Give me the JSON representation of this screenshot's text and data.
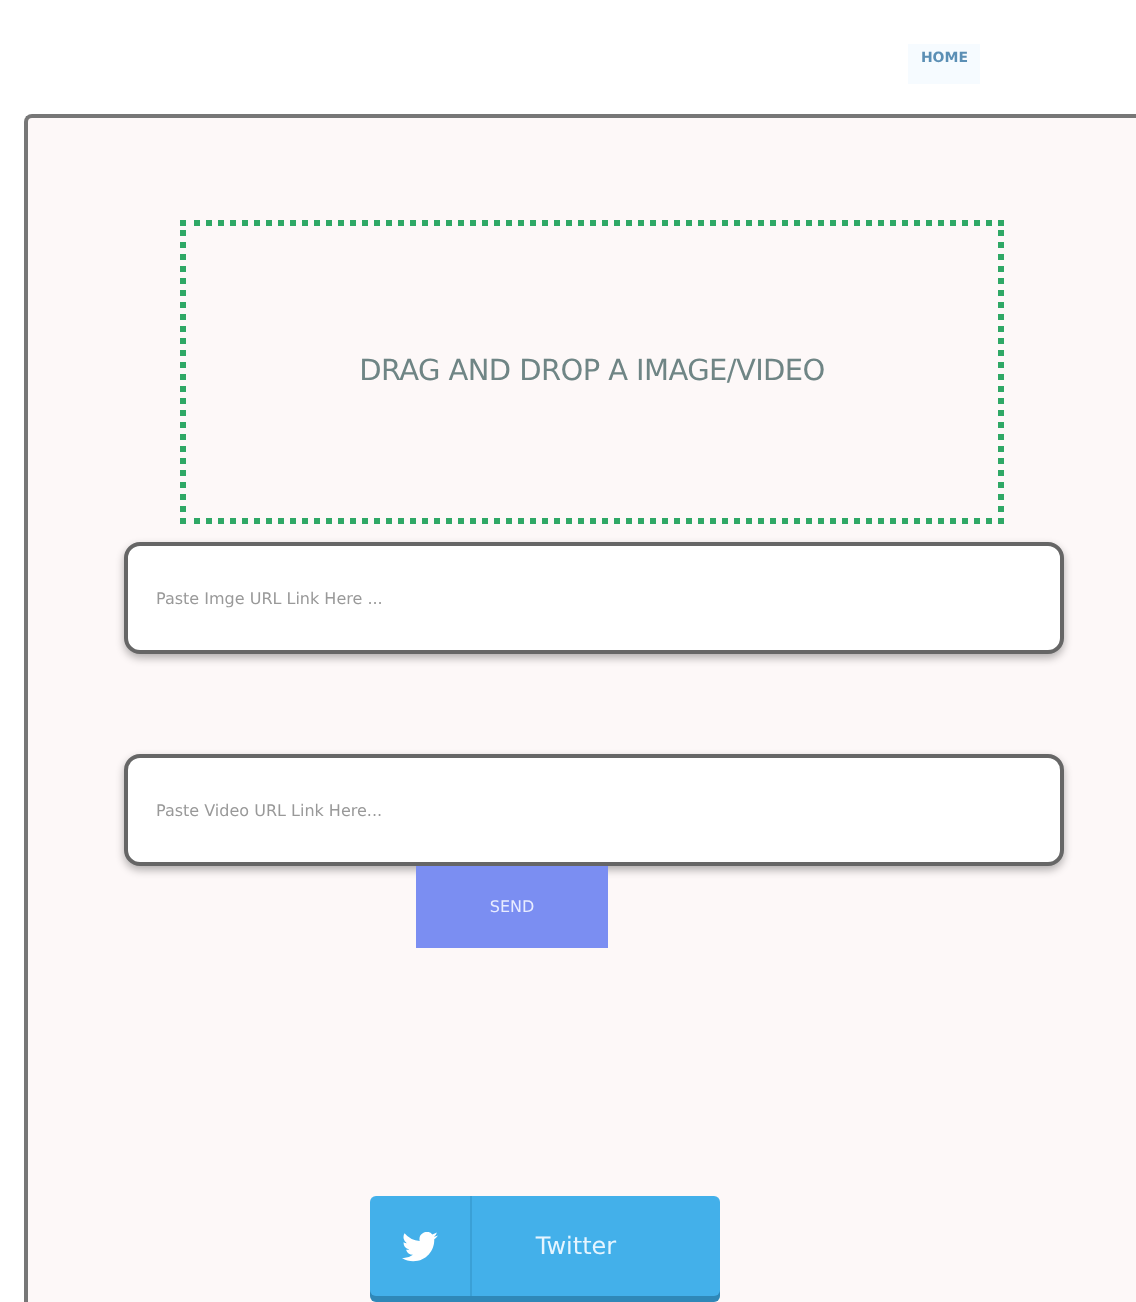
{
  "nav": {
    "home": "HOME"
  },
  "dropzone": {
    "label": "DRAG AND DROP A IMAGE/VIDEO"
  },
  "fields": [
    {
      "placeholder": "Paste Imge URL Link Here ..."
    },
    {
      "placeholder": "Paste Video URL Link Here..."
    }
  ],
  "send": "SEND",
  "share": {
    "label": "Twitter"
  }
}
